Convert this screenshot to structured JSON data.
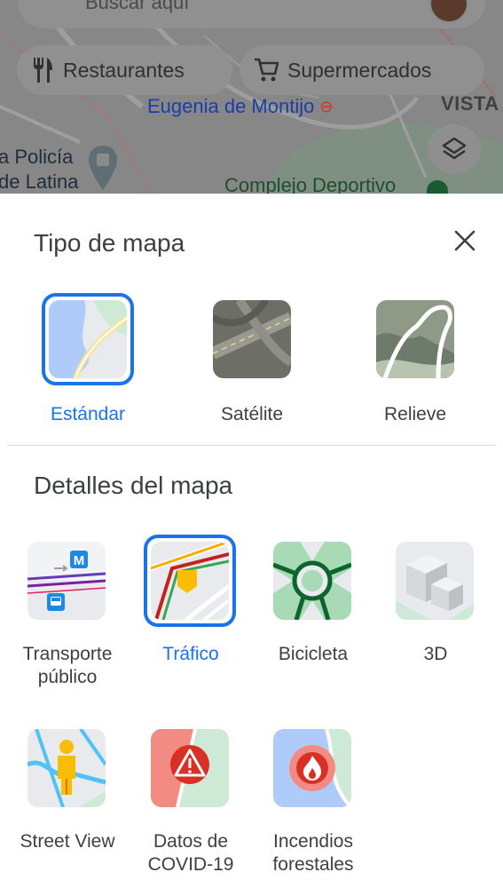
{
  "search": {
    "placeholder": "Buscar aquí"
  },
  "chips": [
    {
      "label": "Restaurantes",
      "icon": "fork-knife-icon"
    },
    {
      "label": "Supermercados",
      "icon": "shopping-cart-icon"
    }
  ],
  "map_labels": {
    "metro": "Eugenia de Montijo",
    "vista": "VISTA",
    "policia_line1": "a Policía",
    "policia_line2": "de Latina",
    "complejo": "Complejo Deportivo"
  },
  "sheet": {
    "map_type_title": "Tipo de mapa",
    "map_details_title": "Detalles del mapa",
    "close_icon": "close-icon"
  },
  "map_types": [
    {
      "label": "Estándar",
      "selected": true
    },
    {
      "label": "Satélite",
      "selected": false
    },
    {
      "label": "Relieve",
      "selected": false
    }
  ],
  "map_details": [
    {
      "label": "Transporte público",
      "selected": false
    },
    {
      "label": "Tráfico",
      "selected": true
    },
    {
      "label": "Bicicleta",
      "selected": false
    },
    {
      "label": "3D",
      "selected": false
    },
    {
      "label": "Street View",
      "selected": false
    },
    {
      "label": "Datos de COVID-19",
      "selected": false
    },
    {
      "label": "Incendios forestales",
      "selected": false
    }
  ],
  "colors": {
    "accent": "#1a73e8",
    "map_overlay": "#8a8a8a",
    "text": "#3c4043"
  }
}
